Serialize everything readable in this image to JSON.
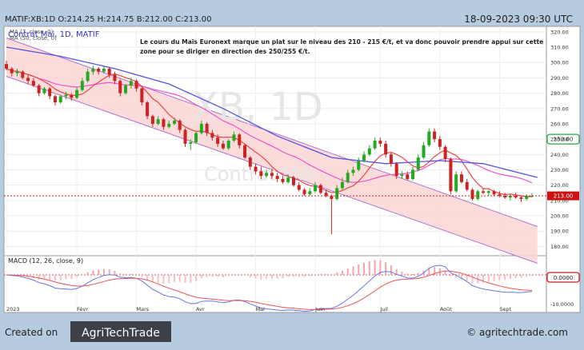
{
  "header": {
    "symbol_line": "MATIF:XB:1D O:214.25 H:214.75 B:212.00 C:213.00",
    "datetime": "18-09-2023 09:30 UTC",
    "title": "Contrat Mai, 1D, MATIF",
    "ma7_label": "MA (7, close, 0)",
    "ma50_label": "MA (50, close, 0)"
  },
  "annotation": {
    "line1": "Le cours du Maïs Euronext marque un plat sur le niveau des 210 - 215 €/t, et va donc pouvoir prendre appui sur cette",
    "line2": "zone pour se diriger en direction des 250/255 €/t."
  },
  "watermark": {
    "big": "XB, 1D",
    "small": "Contrat MAI"
  },
  "price_tags": {
    "last": "213.00",
    "target": "250.00",
    "macd_zero": "0.0000"
  },
  "macd_panel": {
    "title": "MACD (12, 26, close, 9)"
  },
  "footer": {
    "created_on": "Created on",
    "brand": "AgriTechTrade",
    "copyright": "© agritechtrade.com"
  },
  "colors": {
    "background": "#b7cbe0",
    "chart_bg": "#ffffff",
    "up_candle": "#22aa22",
    "down_candle": "#cc2222",
    "ma7": "#ee4444",
    "ma20": "#ee55cc",
    "ma50": "#5555dd",
    "channel_fill": "#fbd5d5",
    "channel_line": "#aa77cc",
    "last_price_tag": "#cc1111",
    "target_tag": "#22aa44",
    "brand_box": "#3c4048"
  },
  "chart_data": [
    {
      "type": "candlestick",
      "x_ticks": [
        "2023",
        "Févr",
        "Mars",
        "Avr",
        "Mai",
        "Juin",
        "Juil",
        "Août",
        "Sept"
      ],
      "y_ticks": [
        "320.00",
        "310.00",
        "300.00",
        "290.00",
        "280.00",
        "270.00",
        "260.00",
        "250.00",
        "240.00",
        "230.00",
        "220.00",
        "210.00",
        "200.00",
        "190.00",
        "180.00"
      ],
      "ylim": [
        175,
        322
      ],
      "candles": [
        {
          "o": 299,
          "h": 301,
          "l": 295,
          "c": 296
        },
        {
          "o": 296,
          "h": 297,
          "l": 291,
          "c": 293
        },
        {
          "o": 293,
          "h": 296,
          "l": 291,
          "c": 294
        },
        {
          "o": 294,
          "h": 295,
          "l": 289,
          "c": 290
        },
        {
          "o": 290,
          "h": 292,
          "l": 286,
          "c": 288
        },
        {
          "o": 288,
          "h": 290,
          "l": 284,
          "c": 285
        },
        {
          "o": 285,
          "h": 286,
          "l": 278,
          "c": 280
        },
        {
          "o": 280,
          "h": 284,
          "l": 279,
          "c": 283
        },
        {
          "o": 283,
          "h": 284,
          "l": 276,
          "c": 278
        },
        {
          "o": 278,
          "h": 279,
          "l": 272,
          "c": 274
        },
        {
          "o": 274,
          "h": 279,
          "l": 273,
          "c": 278
        },
        {
          "o": 278,
          "h": 281,
          "l": 276,
          "c": 279
        },
        {
          "o": 279,
          "h": 280,
          "l": 275,
          "c": 277
        },
        {
          "o": 277,
          "h": 284,
          "l": 276,
          "c": 282
        },
        {
          "o": 282,
          "h": 290,
          "l": 281,
          "c": 288
        },
        {
          "o": 288,
          "h": 296,
          "l": 287,
          "c": 294
        },
        {
          "o": 294,
          "h": 298,
          "l": 292,
          "c": 296
        },
        {
          "o": 296,
          "h": 297,
          "l": 292,
          "c": 294
        },
        {
          "o": 294,
          "h": 298,
          "l": 293,
          "c": 296
        },
        {
          "o": 296,
          "h": 297,
          "l": 290,
          "c": 292
        },
        {
          "o": 292,
          "h": 294,
          "l": 286,
          "c": 288
        },
        {
          "o": 288,
          "h": 289,
          "l": 278,
          "c": 280
        },
        {
          "o": 280,
          "h": 286,
          "l": 279,
          "c": 285
        },
        {
          "o": 285,
          "h": 290,
          "l": 283,
          "c": 288
        },
        {
          "o": 288,
          "h": 289,
          "l": 281,
          "c": 283
        },
        {
          "o": 283,
          "h": 284,
          "l": 272,
          "c": 274
        },
        {
          "o": 274,
          "h": 275,
          "l": 263,
          "c": 265
        },
        {
          "o": 265,
          "h": 266,
          "l": 258,
          "c": 260
        },
        {
          "o": 260,
          "h": 265,
          "l": 259,
          "c": 263
        },
        {
          "o": 263,
          "h": 264,
          "l": 256,
          "c": 258
        },
        {
          "o": 258,
          "h": 262,
          "l": 257,
          "c": 260
        },
        {
          "o": 260,
          "h": 264,
          "l": 259,
          "c": 262
        },
        {
          "o": 262,
          "h": 263,
          "l": 254,
          "c": 256
        },
        {
          "o": 256,
          "h": 257,
          "l": 245,
          "c": 247
        },
        {
          "o": 247,
          "h": 250,
          "l": 243,
          "c": 248
        },
        {
          "o": 248,
          "h": 255,
          "l": 247,
          "c": 254
        },
        {
          "o": 254,
          "h": 262,
          "l": 253,
          "c": 260
        },
        {
          "o": 260,
          "h": 261,
          "l": 252,
          "c": 254
        },
        {
          "o": 254,
          "h": 256,
          "l": 249,
          "c": 251
        },
        {
          "o": 251,
          "h": 253,
          "l": 245,
          "c": 247
        },
        {
          "o": 247,
          "h": 249,
          "l": 243,
          "c": 244
        },
        {
          "o": 244,
          "h": 250,
          "l": 243,
          "c": 249
        },
        {
          "o": 249,
          "h": 255,
          "l": 248,
          "c": 253
        },
        {
          "o": 253,
          "h": 254,
          "l": 244,
          "c": 246
        },
        {
          "o": 246,
          "h": 247,
          "l": 237,
          "c": 238
        },
        {
          "o": 238,
          "h": 239,
          "l": 230,
          "c": 232
        },
        {
          "o": 232,
          "h": 234,
          "l": 227,
          "c": 229
        },
        {
          "o": 229,
          "h": 232,
          "l": 224,
          "c": 226
        },
        {
          "o": 226,
          "h": 230,
          "l": 225,
          "c": 228
        },
        {
          "o": 228,
          "h": 231,
          "l": 224,
          "c": 226
        },
        {
          "o": 226,
          "h": 228,
          "l": 222,
          "c": 224
        },
        {
          "o": 224,
          "h": 226,
          "l": 221,
          "c": 222
        },
        {
          "o": 222,
          "h": 227,
          "l": 221,
          "c": 225
        },
        {
          "o": 225,
          "h": 226,
          "l": 219,
          "c": 220
        },
        {
          "o": 220,
          "h": 222,
          "l": 216,
          "c": 217
        },
        {
          "o": 217,
          "h": 218,
          "l": 213,
          "c": 214
        },
        {
          "o": 214,
          "h": 218,
          "l": 213,
          "c": 216
        },
        {
          "o": 216,
          "h": 222,
          "l": 215,
          "c": 220
        },
        {
          "o": 220,
          "h": 221,
          "l": 214,
          "c": 215
        },
        {
          "o": 215,
          "h": 217,
          "l": 212,
          "c": 213
        },
        {
          "o": 213,
          "h": 214,
          "l": 188,
          "c": 211
        },
        {
          "o": 211,
          "h": 220,
          "l": 210,
          "c": 218
        },
        {
          "o": 218,
          "h": 225,
          "l": 217,
          "c": 222
        },
        {
          "o": 222,
          "h": 230,
          "l": 221,
          "c": 228
        },
        {
          "o": 228,
          "h": 232,
          "l": 226,
          "c": 230
        },
        {
          "o": 230,
          "h": 238,
          "l": 229,
          "c": 236
        },
        {
          "o": 236,
          "h": 242,
          "l": 235,
          "c": 240
        },
        {
          "o": 240,
          "h": 246,
          "l": 239,
          "c": 244
        },
        {
          "o": 244,
          "h": 251,
          "l": 243,
          "c": 249
        },
        {
          "o": 249,
          "h": 251,
          "l": 245,
          "c": 247
        },
        {
          "o": 247,
          "h": 249,
          "l": 238,
          "c": 240
        },
        {
          "o": 240,
          "h": 241,
          "l": 232,
          "c": 234
        },
        {
          "o": 234,
          "h": 235,
          "l": 224,
          "c": 226
        },
        {
          "o": 226,
          "h": 229,
          "l": 224,
          "c": 227
        },
        {
          "o": 227,
          "h": 229,
          "l": 223,
          "c": 224
        },
        {
          "o": 224,
          "h": 232,
          "l": 223,
          "c": 230
        },
        {
          "o": 230,
          "h": 240,
          "l": 229,
          "c": 238
        },
        {
          "o": 238,
          "h": 248,
          "l": 237,
          "c": 246
        },
        {
          "o": 246,
          "h": 257,
          "l": 245,
          "c": 255
        },
        {
          "o": 255,
          "h": 257,
          "l": 248,
          "c": 250
        },
        {
          "o": 250,
          "h": 252,
          "l": 243,
          "c": 245
        },
        {
          "o": 245,
          "h": 246,
          "l": 235,
          "c": 237
        },
        {
          "o": 237,
          "h": 238,
          "l": 214,
          "c": 216
        },
        {
          "o": 216,
          "h": 229,
          "l": 215,
          "c": 227
        },
        {
          "o": 227,
          "h": 229,
          "l": 221,
          "c": 222
        },
        {
          "o": 222,
          "h": 224,
          "l": 216,
          "c": 217
        },
        {
          "o": 217,
          "h": 218,
          "l": 210,
          "c": 211
        },
        {
          "o": 211,
          "h": 217,
          "l": 210,
          "c": 216
        },
        {
          "o": 216,
          "h": 218,
          "l": 214,
          "c": 215
        },
        {
          "o": 215,
          "h": 217,
          "l": 213,
          "c": 216
        },
        {
          "o": 216,
          "h": 217,
          "l": 213,
          "c": 214
        },
        {
          "o": 214,
          "h": 216,
          "l": 212,
          "c": 213
        },
        {
          "o": 213,
          "h": 215,
          "l": 211,
          "c": 212
        },
        {
          "o": 212,
          "h": 214,
          "l": 210,
          "c": 213
        },
        {
          "o": 213,
          "h": 215,
          "l": 211,
          "c": 212
        },
        {
          "o": 212,
          "h": 213,
          "l": 209,
          "c": 211
        },
        {
          "o": 211,
          "h": 214,
          "l": 210,
          "c": 213
        },
        {
          "o": 213,
          "h": 214.75,
          "l": 212,
          "c": 213
        }
      ],
      "ma50_points": [
        {
          "i": 0,
          "v": 310
        },
        {
          "i": 10,
          "v": 304
        },
        {
          "i": 20,
          "v": 296
        },
        {
          "i": 30,
          "v": 286
        },
        {
          "i": 40,
          "v": 270
        },
        {
          "i": 50,
          "v": 252
        },
        {
          "i": 60,
          "v": 238
        },
        {
          "i": 70,
          "v": 234
        },
        {
          "i": 80,
          "v": 236
        },
        {
          "i": 88,
          "v": 234
        },
        {
          "i": 98,
          "v": 225
        }
      ],
      "channel": {
        "upper": [
          {
            "i": 0,
            "v": 316
          },
          {
            "i": 98,
            "v": 193
          }
        ],
        "lower": [
          {
            "i": 0,
            "v": 291
          },
          {
            "i": 98,
            "v": 169
          }
        ]
      }
    },
    {
      "type": "line",
      "title": "MACD (12, 26, close, 9)",
      "y_ticks": [
        "0.0000",
        "-10.0000"
      ],
      "ylim": [
        -12,
        6
      ]
    }
  ]
}
